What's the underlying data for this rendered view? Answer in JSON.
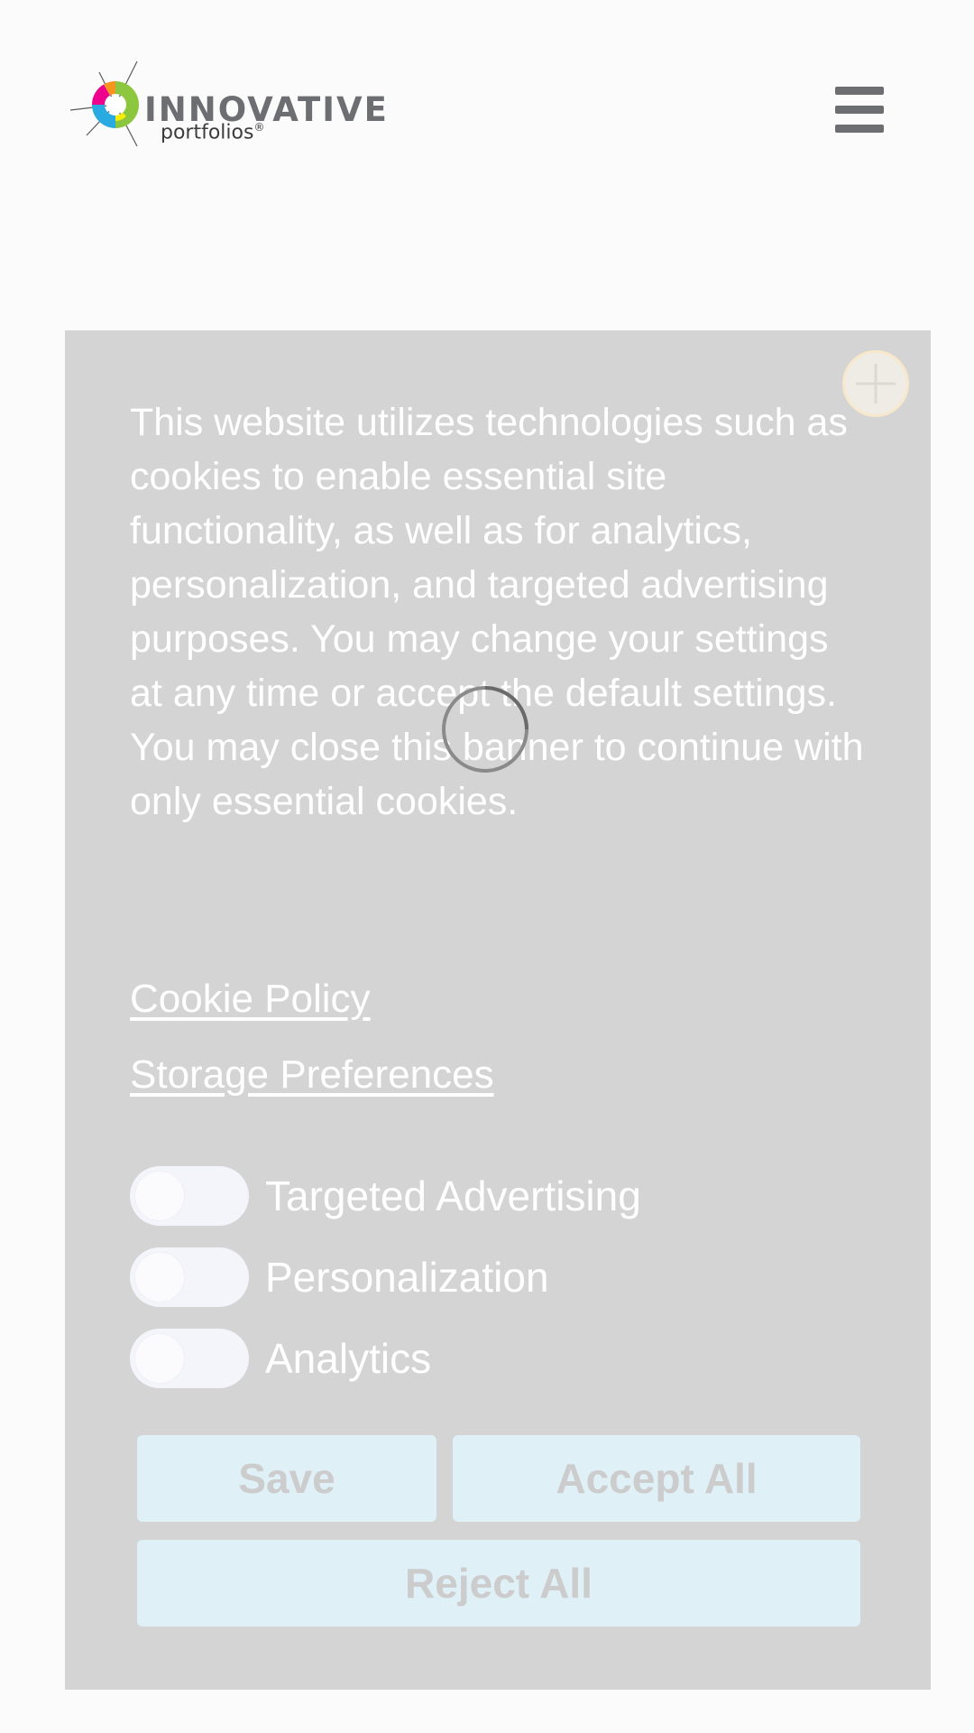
{
  "header": {
    "logo": {
      "wordmark": "INNOVATIVE",
      "tagline": "portfolios",
      "registered": "®"
    },
    "menu_icon": "hamburger-menu-icon"
  },
  "banner": {
    "close_icon": "close-icon",
    "message": "This website utilizes technologies such as cookies to enable essential site functionality, as well as for analytics, personalization, and targeted advertising purposes. You may change your settings at any time or accept the default settings. You may close this banner to continue with only essential cookies.",
    "cookie_policy_link": "Cookie Policy",
    "storage_preferences_link": "Storage Preferences",
    "toggles": [
      {
        "label": "Targeted Advertising",
        "enabled": false
      },
      {
        "label": "Personalization",
        "enabled": false
      },
      {
        "label": "Analytics",
        "enabled": false
      }
    ],
    "buttons": {
      "save": "Save",
      "accept_all": "Accept All",
      "reject_all": "Reject All"
    },
    "loading_icon": "spinner-icon"
  },
  "colors": {
    "page_background": "#fbfbfb",
    "banner_background": "#d4d4d4",
    "button_background": "#dff0f7",
    "button_text": "#cccccc",
    "logo_text": "#6d6e71"
  }
}
